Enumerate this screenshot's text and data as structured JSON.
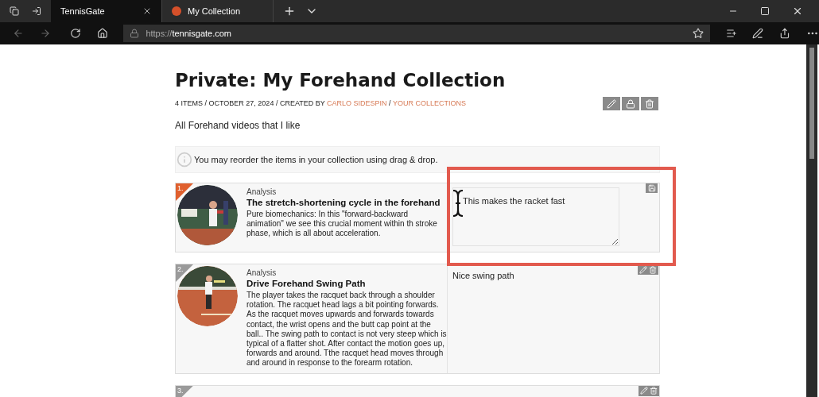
{
  "browser": {
    "tabs": [
      {
        "title": "TennisGate",
        "selected": true,
        "kind": "plain"
      },
      {
        "title": "My Collection",
        "selected": false,
        "kind": "favicon"
      }
    ],
    "address": {
      "scheme": "https://",
      "host": "tennisgate.com"
    }
  },
  "page": {
    "title": "Private: My Forehand Collection",
    "meta": [
      {
        "text": "4 ITEMS / OCTOBER 27, 2024 / CREATED BY ",
        "kind": "plain"
      },
      {
        "text": "CARLO SIDESPIN",
        "kind": "link"
      },
      {
        "text": " / ",
        "kind": "plain"
      },
      {
        "text": "YOUR COLLECTIONS",
        "kind": "link"
      }
    ],
    "description": "All Forehand videos that I like",
    "notice": "You may reorder the items in your collection using drag & drop.",
    "items": [
      {
        "number": "1.",
        "selected": true,
        "kind": "editing",
        "category": "Analysis",
        "title": "The stretch-shortening cycle in the forehand",
        "text": "Pure biomechanics: In this \"forward-backward animation\" we see this crucial moment within th stroke phase, which is all about acceleration.",
        "note": "This makes the racket fast"
      },
      {
        "number": "2.",
        "selected": false,
        "kind": "note",
        "category": "Analysis",
        "title": "Drive Forehand Swing Path",
        "text": "The player takes the racquet back through a shoulder rotation. The racquet head lags a bit pointing forwards. As the racquet moves upwards and forwards towards contact, the wrist opens and the butt cap point at the ball.. The swing path to contact is not very steep which is typical of a flatter shot. After contact the motion goes up, forwards and around. Tthe racquet head moves through and around in response to the forearm rotation.",
        "note": "Nice swing path"
      },
      {
        "number": "3.",
        "selected": false,
        "kind": "cut"
      }
    ]
  }
}
